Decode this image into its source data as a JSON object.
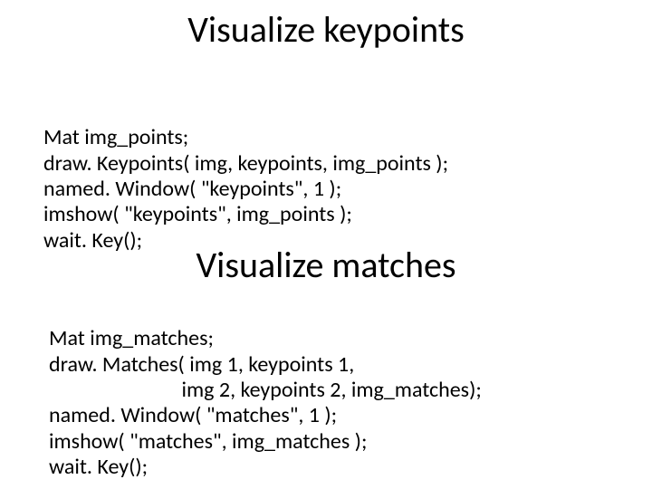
{
  "heading1": "Visualize keypoints",
  "code1_line1": "Mat img_points;",
  "code1_line2": "draw. Keypoints( img, keypoints, img_points );",
  "code1_line3": "named. Window( \"keypoints\", 1 );",
  "code1_line4": "imshow( \"keypoints\", img_points );",
  "code1_line5": "wait. Key();",
  "heading2": "Visualize matches",
  "code2_line1": "Mat img_matches;",
  "code2_line2": "draw. Matches( img 1, keypoints 1,",
  "code2_line3": "                           img 2, keypoints 2, img_matches);",
  "code2_line4": "named. Window( \"matches\", 1 );",
  "code2_line5": "imshow( \"matches\", img_matches );",
  "code2_line6": "wait. Key();"
}
